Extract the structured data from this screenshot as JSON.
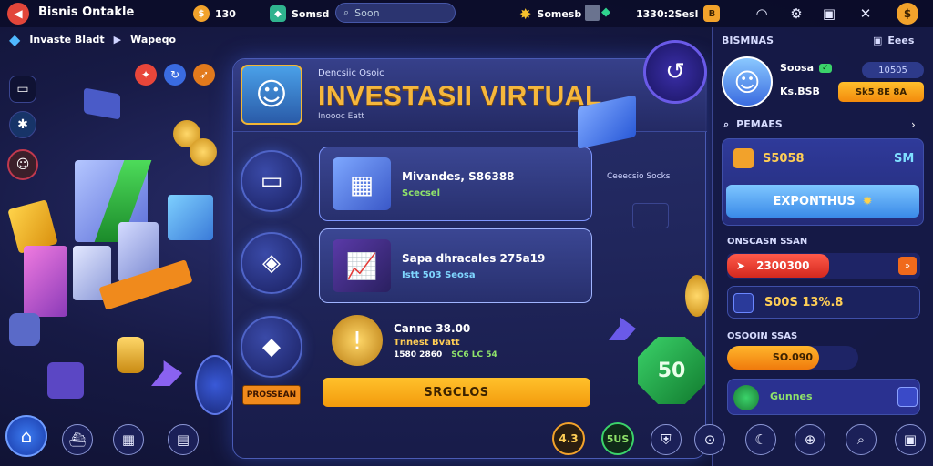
{
  "app": {
    "title": "Bisnis Ontakle",
    "logo": "◀"
  },
  "topbar": {
    "coins": {
      "value": "130",
      "icon": "coin-icon",
      "color": "#f2a22b"
    },
    "gems": {
      "value": "Somsd",
      "icon": "gem-icon",
      "color": "#2fb38e"
    },
    "search": {
      "placeholder": "Soon"
    },
    "stars": {
      "value": "Somesb",
      "icon": "star-icon"
    },
    "balance": {
      "value": "1330:2Sesl",
      "icon": "gold-chip-icon"
    }
  },
  "subrow": {
    "primary": "Invaste Bladt",
    "secondary": "Wapeqo"
  },
  "panel": {
    "kicker": "Dencsiic Osoic",
    "title": "INVESTASII VIRTUAL",
    "subkicker": "Inoooc Eatt",
    "right_caption": "Ceeecsio Socks",
    "items": [
      {
        "title": "Mivandes, S86388",
        "sub": "Scecsel",
        "sub_color": "#8fe36a"
      },
      {
        "title": "Sapa dhracales 275a19",
        "sub": "Istt 503 Seosa",
        "sub_color": "#7fd6ff"
      },
      {
        "title": "Canne 38.00",
        "sub": "Tnnest Bvatt",
        "sub_color": "#ffce55",
        "meta": [
          "1580 2860",
          "SC6 LC 54"
        ]
      }
    ],
    "cta_label": "SRGCLOS",
    "tag_label": "PROSSEAN"
  },
  "sidebar": {
    "header_left": "BISMNAS",
    "header_right": "Eees",
    "profile": {
      "name": "Soosa",
      "chip": "10505",
      "value": "Ks.BSB",
      "button": "Sk5 8E 8A"
    },
    "section_title": "PEMAES",
    "wallet": {
      "left": "S5058",
      "right": "SM"
    },
    "expand_button": "EXPONTHUS",
    "list_title": "ONSCASN SSAN",
    "row1": "2300300",
    "row2": "S00S 13%.8",
    "progress_title": "OSOOIN SSAS",
    "progress_value": "SO.090",
    "progress_percent": 70,
    "footer_text": "Gunnes"
  },
  "bottom_nav": {
    "items": [
      {
        "name": "level-badge",
        "label": "4.3"
      },
      {
        "name": "stat-badge",
        "label": "5US"
      }
    ]
  },
  "deco": {
    "coin_value": "50"
  }
}
